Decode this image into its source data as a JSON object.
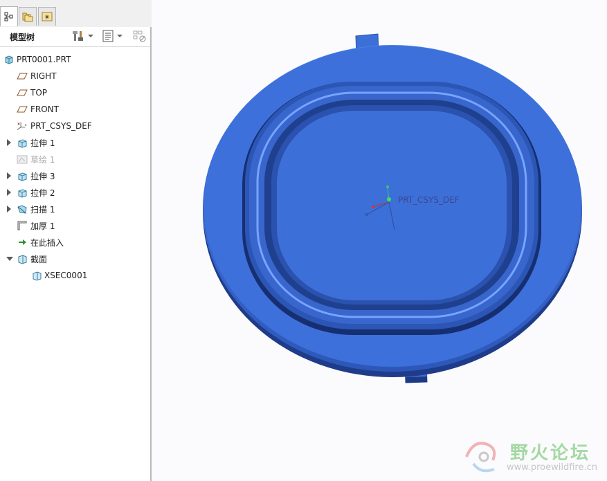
{
  "tabs": [
    {
      "name": "model-tree-tab",
      "active": true
    },
    {
      "name": "folder-browser-tab",
      "active": false
    },
    {
      "name": "favorites-tab",
      "active": false
    }
  ],
  "panel": {
    "title": "模型树"
  },
  "tree": {
    "root": "PRT0001.PRT",
    "items": [
      {
        "label": "RIGHT",
        "icon": "datum-plane-icon"
      },
      {
        "label": "TOP",
        "icon": "datum-plane-icon"
      },
      {
        "label": "FRONT",
        "icon": "datum-plane-icon"
      },
      {
        "label": "PRT_CSYS_DEF",
        "icon": "csys-icon"
      },
      {
        "label": "拉伸 1",
        "icon": "extrude-icon"
      },
      {
        "label": "草绘 1",
        "icon": "sketch-icon"
      },
      {
        "label": "拉伸 3",
        "icon": "extrude-icon"
      },
      {
        "label": "拉伸 2",
        "icon": "extrude-icon"
      },
      {
        "label": "扫描 1",
        "icon": "sweep-icon"
      },
      {
        "label": "加厚 1",
        "icon": "thicken-icon"
      },
      {
        "label": "在此插入",
        "icon": "insert-here-arrow-icon"
      },
      {
        "label": "截面",
        "icon": "section-icon"
      },
      {
        "label": "XSEC0001",
        "icon": "section-icon"
      }
    ]
  },
  "viewport": {
    "csys_label": "PRT_CSYS_DEF",
    "model_color": "#3d6fd8"
  },
  "watermark": {
    "title": "野火论坛",
    "url": "www.proewildfire.cn"
  }
}
